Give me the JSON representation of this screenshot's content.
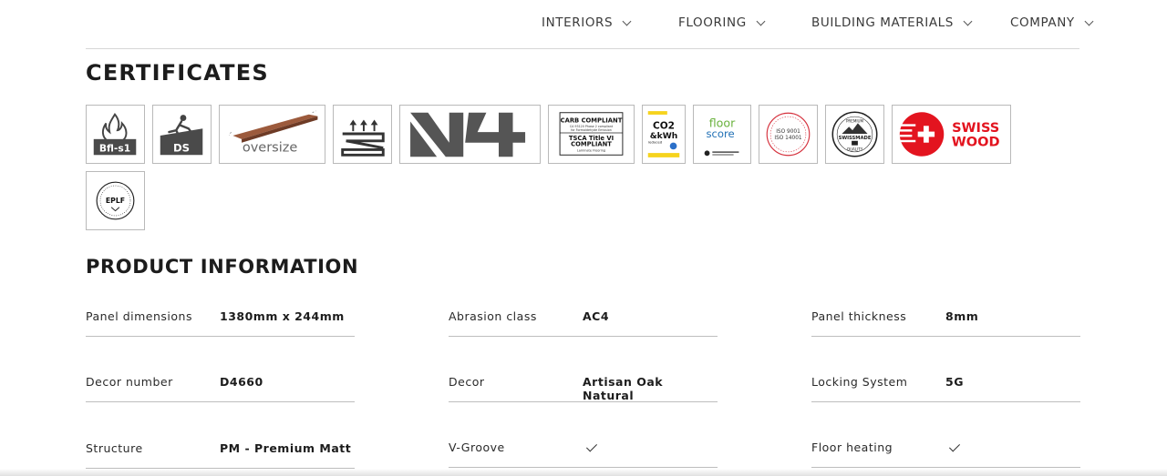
{
  "nav": {
    "items": [
      {
        "label": "INTERIORS"
      },
      {
        "label": "FLOORING"
      },
      {
        "label": "BUILDING MATERIALS"
      },
      {
        "label": "COMPANY"
      }
    ]
  },
  "certificates": {
    "heading": "CERTIFICATES",
    "badges": {
      "fire": {
        "text": "Bfl-s1"
      },
      "ds": {
        "text": "DS"
      },
      "oversize": {
        "text": "oversize"
      },
      "v4": {
        "text": "V4"
      },
      "carb": {
        "line1": "CARB COMPLIANT",
        "line2": "CA 93120 Phase 2 compliant",
        "line3": "for Formaldehyde Emission",
        "line4": "TSCA Title VI",
        "line5": "COMPLIANT",
        "line6": "Laminate Flooring"
      },
      "co2": {
        "line1": "CO2",
        "line2": "&kWh",
        "line3": "reduced"
      },
      "floorscore": {
        "line1": "floor",
        "line2": "score"
      },
      "iso": {
        "line1": "ISO 9001",
        "line2": "ISO 14001"
      },
      "swissmade": {
        "line1": "PREMIUM",
        "line2": "SWISSMADE",
        "line3": "QUALITY"
      },
      "swisswood": {
        "line1": "SWISS",
        "line2": "WOOD"
      },
      "eplf": {
        "text": "EPLF"
      }
    }
  },
  "product": {
    "heading": "PRODUCT INFORMATION",
    "rows": [
      [
        {
          "label": "Panel dimensions",
          "value": "1380mm x 244mm"
        },
        {
          "label": "Abrasion class",
          "value": "AC4"
        },
        {
          "label": "Panel thickness",
          "value": "8mm"
        }
      ],
      [
        {
          "label": "Decor number",
          "value": "D4660"
        },
        {
          "label": "Decor",
          "value": "Artisan Oak Natural"
        },
        {
          "label": "Locking System",
          "value": "5G"
        }
      ],
      [
        {
          "label": "Structure",
          "value": "PM - Premium Matt"
        },
        {
          "label": "V-Groove",
          "value": ""
        },
        {
          "label": "Floor heating",
          "value": ""
        }
      ]
    ]
  },
  "colors": {
    "text": "#1c1c1c",
    "rule": "#bdbdbd",
    "swisswood_red": "#e3141f",
    "co2_yellow": "#f6d31d",
    "floorscore_green": "#6ab23e",
    "floorscore_blue": "#1f6fb5",
    "iso_red": "#d6333f"
  }
}
